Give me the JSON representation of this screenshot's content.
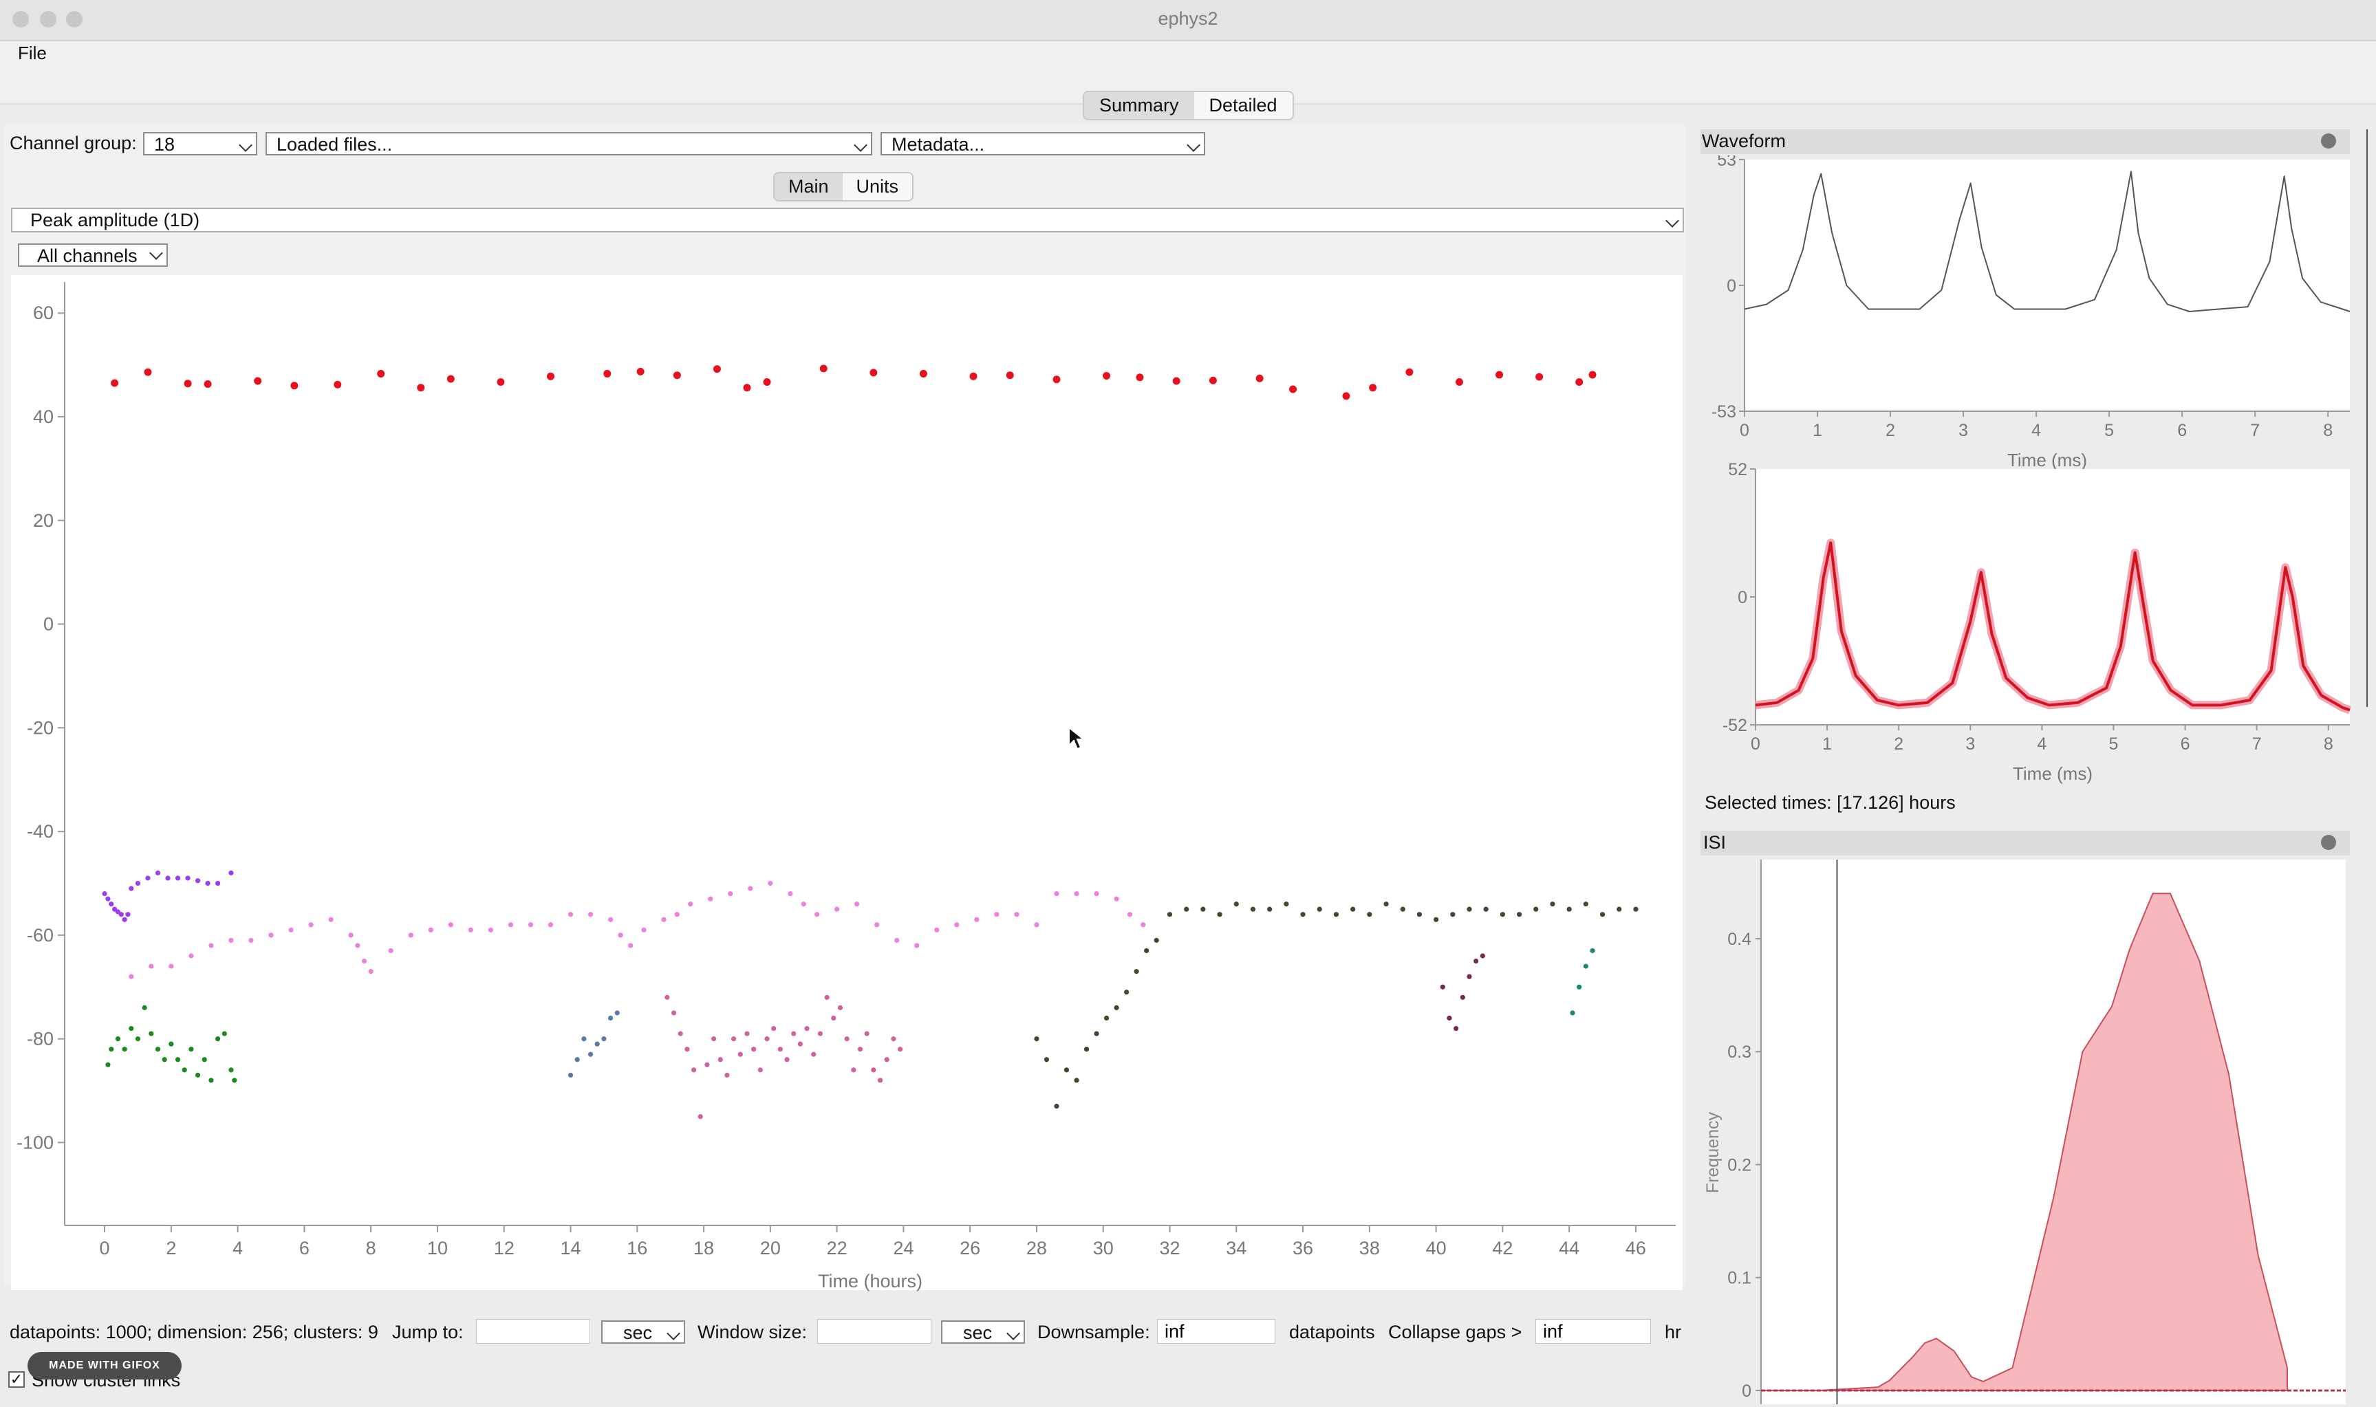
{
  "window": {
    "title": "ephys2"
  },
  "menu": {
    "file": "File"
  },
  "top_tabs": {
    "summary": "Summary",
    "detailed": "Detailed",
    "active": "Summary"
  },
  "controls": {
    "channel_group_label": "Channel group:",
    "channel_group_value": "18",
    "loaded_files": "Loaded files...",
    "metadata": "Metadata..."
  },
  "sub_tabs": {
    "main": "Main",
    "units": "Units",
    "active": "Main"
  },
  "plot_select": "Peak amplitude (1D)",
  "channel_select": "All channels",
  "waveform_panel": {
    "title": "Waveform"
  },
  "selected_times": "Selected times: [17.126] hours",
  "isi_panel": {
    "title": "ISI"
  },
  "status": {
    "summary": "datapoints: 1000; dimension: 256; clusters: 9",
    "jump_to_label": "Jump to:",
    "jump_to_value": "",
    "jump_unit": "sec",
    "window_size_label": "Window size:",
    "window_size_value": "",
    "window_unit": "sec",
    "downsample_label": "Downsample:",
    "downsample_value": "inf",
    "datapoints_label": "datapoints",
    "collapse_label": "Collapse gaps >",
    "collapse_value": "inf",
    "collapse_unit": "hr",
    "show_links_label": "Show cluster links",
    "show_links_checked": true,
    "gifox_badge": "MADE WITH GIFOX"
  },
  "colors": {
    "cluster_red": "#e8101d",
    "cluster_purple": "#9b3cf0",
    "cluster_pink": "#ef7fdc",
    "cluster_magenta": "#d1609c",
    "cluster_green": "#1a8a1a",
    "cluster_steel": "#5a79a8",
    "cluster_darkgreen": "#3d4a30",
    "cluster_maroon": "#7a2c3c",
    "cluster_teal": "#1c8a6e",
    "waveform_black": "#555555",
    "waveform_red": "#d4141c",
    "isi_fill": "#f6b8bc",
    "isi_line": "#c94f5a"
  },
  "chart_data": [
    {
      "type": "scatter",
      "title": "",
      "xlabel": "Time (hours)",
      "ylabel": "",
      "xlim": [
        -1.2,
        47.2
      ],
      "ylim": [
        -116,
        66
      ],
      "xticks": [
        0,
        2,
        4,
        6,
        8,
        10,
        12,
        14,
        16,
        18,
        20,
        22,
        24,
        26,
        28,
        30,
        32,
        34,
        36,
        38,
        40,
        42,
        44,
        46
      ],
      "yticks": [
        60,
        40,
        20,
        0,
        -20,
        -40,
        -60,
        -80,
        -100
      ],
      "grid": false,
      "series": [
        {
          "color": "#e8101d",
          "marker": "big",
          "x": [
            0.3,
            1.3,
            2.5,
            3.1,
            4.6,
            5.7,
            7.0,
            8.3,
            9.5,
            10.4,
            11.9,
            13.4,
            15.1,
            16.1,
            17.2,
            18.4,
            19.3,
            19.9,
            21.6,
            23.1,
            24.6,
            26.1,
            27.2,
            28.6,
            30.1,
            31.1,
            32.2,
            33.3,
            34.7,
            35.7,
            37.3,
            38.1,
            39.2,
            40.7,
            41.9,
            43.1,
            44.3,
            44.7
          ],
          "y": [
            46.5,
            48.6,
            46.4,
            46.3,
            46.9,
            46.0,
            46.2,
            48.3,
            45.6,
            47.3,
            46.7,
            47.8,
            48.3,
            48.7,
            48.0,
            49.2,
            45.6,
            46.7,
            49.3,
            48.5,
            48.3,
            47.8,
            48.0,
            47.2,
            47.9,
            47.6,
            46.9,
            47.0,
            47.4,
            45.3,
            44.0,
            45.6,
            48.6,
            46.7,
            48.1,
            47.7,
            46.7,
            48.1
          ]
        },
        {
          "color": "#9b3cf0",
          "marker": "small",
          "x": [
            0.0,
            0.1,
            0.2,
            0.3,
            0.4,
            0.5,
            0.6,
            0.7,
            0.8,
            1.0,
            1.3,
            1.6,
            1.9,
            2.2,
            2.5,
            2.8,
            3.1,
            3.4,
            3.8
          ],
          "y": [
            -52,
            -53,
            -54,
            -55,
            -55.5,
            -56,
            -57,
            -56,
            -51,
            -50,
            -49,
            -48,
            -49,
            -49,
            -49,
            -49.5,
            -50,
            -50,
            -48
          ]
        },
        {
          "color": "#ef7fdc",
          "marker": "small",
          "x": [
            0.8,
            1.4,
            2.0,
            2.6,
            3.2,
            3.8,
            4.4,
            5.0,
            5.6,
            6.2,
            6.8,
            7.4,
            7.6,
            7.8,
            8.0,
            8.6,
            9.2,
            9.8,
            10.4,
            11.0,
            11.6,
            12.2,
            12.8,
            13.4,
            14.0,
            14.6,
            15.2,
            15.5,
            15.8,
            16.2,
            16.8,
            17.2,
            17.6,
            18.2,
            18.8,
            19.4,
            20.0,
            20.6,
            21.0,
            21.4,
            22.0,
            22.6,
            23.2,
            23.8,
            24.4,
            25.0,
            25.6,
            26.2,
            26.8,
            27.4,
            28.0,
            28.6,
            29.2,
            29.8,
            30.4,
            30.8,
            31.2
          ],
          "y": [
            -68,
            -66,
            -66,
            -64,
            -62,
            -61,
            -61,
            -60,
            -59,
            -58,
            -57,
            -60,
            -62,
            -65,
            -67,
            -63,
            -60,
            -59,
            -58,
            -59,
            -59,
            -58,
            -58,
            -58,
            -56,
            -56,
            -57,
            -60,
            -62,
            -59,
            -57,
            -56,
            -54,
            -53,
            -52,
            -51,
            -50,
            -52,
            -54,
            -56,
            -55,
            -54,
            -58,
            -61,
            -62,
            -59,
            -58,
            -57,
            -56,
            -56,
            -58,
            -52,
            -52,
            -52,
            -53,
            -56,
            -58
          ]
        },
        {
          "color": "#d1609c",
          "marker": "small",
          "x": [
            16.9,
            17.1,
            17.3,
            17.5,
            17.7,
            17.9,
            18.1,
            18.3,
            18.5,
            18.7,
            18.9,
            19.1,
            19.3,
            19.5,
            19.7,
            19.9,
            20.1,
            20.3,
            20.5,
            20.7,
            20.9,
            21.1,
            21.3,
            21.5,
            21.7,
            21.9,
            22.1,
            22.3,
            22.5,
            22.7,
            22.9,
            23.1,
            23.3,
            23.5,
            23.7,
            23.9
          ],
          "y": [
            -72,
            -75,
            -79,
            -82,
            -86,
            -95,
            -85,
            -80,
            -84,
            -87,
            -80,
            -83,
            -79,
            -82,
            -86,
            -80,
            -78,
            -82,
            -84,
            -79,
            -81,
            -78,
            -83,
            -79,
            -72,
            -76,
            -74,
            -80,
            -86,
            -82,
            -79,
            -86,
            -88,
            -84,
            -80,
            -82
          ]
        },
        {
          "color": "#1a8a1a",
          "marker": "small",
          "x": [
            0.1,
            0.2,
            0.4,
            0.6,
            0.8,
            1.0,
            1.2,
            1.4,
            1.6,
            1.8,
            2.0,
            2.2,
            2.4,
            2.6,
            2.8,
            3.0,
            3.2,
            3.4,
            3.6,
            3.8,
            3.9
          ],
          "y": [
            -85,
            -82,
            -80,
            -82,
            -78,
            -80,
            -74,
            -79,
            -82,
            -84,
            -81,
            -84,
            -86,
            -82,
            -87,
            -84,
            -88,
            -80,
            -79,
            -86,
            -88
          ]
        },
        {
          "color": "#5a79a8",
          "marker": "small",
          "x": [
            14.0,
            14.2,
            14.4,
            14.6,
            14.8,
            15.0,
            15.2,
            15.4
          ],
          "y": [
            -87,
            -84,
            -80,
            -83,
            -81,
            -80,
            -76,
            -75
          ]
        },
        {
          "color": "#3d4a30",
          "marker": "small",
          "x": [
            28.0,
            28.3,
            28.6,
            28.9,
            29.2,
            29.5,
            29.8,
            30.1,
            30.4,
            30.7,
            31.0,
            31.3,
            31.6,
            32.0,
            32.5,
            33.0,
            33.5,
            34.0,
            34.5,
            35.0,
            35.5,
            36.0,
            36.5,
            37.0,
            37.5,
            38.0,
            38.5,
            39.0,
            39.5,
            40.0,
            40.5,
            41.0,
            41.5,
            42.0,
            42.5,
            43.0,
            43.5,
            44.0,
            44.5,
            45.0,
            45.5,
            46.0
          ],
          "y": [
            -80,
            -84,
            -93,
            -86,
            -88,
            -82,
            -79,
            -76,
            -74,
            -71,
            -67,
            -63,
            -61,
            -56,
            -55,
            -55,
            -56,
            -54,
            -55,
            -55,
            -54,
            -56,
            -55,
            -56,
            -55,
            -56,
            -54,
            -55,
            -56,
            -57,
            -56,
            -55,
            -55,
            -56,
            -56,
            -55,
            -54,
            -55,
            -54,
            -56,
            -55,
            -55
          ]
        },
        {
          "color": "#7a2c3c",
          "marker": "small",
          "x": [
            40.2,
            40.4,
            40.6,
            40.8,
            41.0,
            41.2,
            41.4
          ],
          "y": [
            -70,
            -76,
            -78,
            -72,
            -68,
            -65,
            -64
          ]
        },
        {
          "color": "#1c8a6e",
          "marker": "small",
          "x": [
            44.1,
            44.3,
            44.5,
            44.7
          ],
          "y": [
            -75,
            -70,
            -66,
            -63
          ]
        }
      ]
    },
    {
      "type": "line",
      "title": "",
      "xlabel": "Time (ms)",
      "ylabel": "",
      "xlim": [
        0,
        8.3
      ],
      "ylim": [
        -53,
        53
      ],
      "xticks": [
        0,
        1,
        2,
        3,
        4,
        5,
        6,
        7,
        8
      ],
      "yticks": [
        "53",
        "0",
        "-53"
      ],
      "series": [
        {
          "color": "#555555",
          "x": [
            0,
            0.3,
            0.6,
            0.8,
            0.95,
            1.05,
            1.2,
            1.4,
            1.7,
            2.0,
            2.4,
            2.7,
            2.95,
            3.1,
            3.25,
            3.45,
            3.7,
            4.0,
            4.4,
            4.8,
            5.1,
            5.3,
            5.4,
            5.55,
            5.8,
            6.1,
            6.5,
            6.9,
            7.2,
            7.4,
            7.5,
            7.65,
            7.9,
            8.2,
            8.3
          ],
          "y": [
            -10,
            -8,
            -2,
            15,
            38,
            47,
            22,
            0,
            -10,
            -10,
            -10,
            -2,
            28,
            43,
            16,
            -4,
            -10,
            -10,
            -10,
            -6,
            15,
            48,
            22,
            3,
            -8,
            -11,
            -10,
            -9,
            10,
            46,
            24,
            3,
            -7,
            -10,
            -11
          ]
        }
      ]
    },
    {
      "type": "line",
      "title": "",
      "xlabel": "Time (ms)",
      "ylabel": "",
      "xlim": [
        0,
        8.3
      ],
      "ylim": [
        -52,
        52
      ],
      "xticks": [
        0,
        1,
        2,
        3,
        4,
        5,
        6,
        7,
        8
      ],
      "yticks": [
        "52",
        "0",
        "-52"
      ],
      "series": [
        {
          "color": "#d4141c",
          "x": [
            0,
            0.3,
            0.6,
            0.8,
            0.95,
            1.05,
            1.2,
            1.4,
            1.7,
            2.0,
            2.4,
            2.75,
            3.0,
            3.15,
            3.3,
            3.5,
            3.8,
            4.1,
            4.5,
            4.9,
            5.1,
            5.3,
            5.4,
            5.55,
            5.8,
            6.1,
            6.5,
            6.9,
            7.2,
            7.4,
            7.5,
            7.65,
            7.9,
            8.2,
            8.3
          ],
          "y": [
            -44,
            -43,
            -38,
            -25,
            8,
            22,
            -14,
            -32,
            -42,
            -44,
            -43,
            -35,
            -10,
            10,
            -15,
            -33,
            -41,
            -44,
            -43,
            -37,
            -20,
            18,
            0,
            -26,
            -38,
            -44,
            -44,
            -42,
            -30,
            12,
            0,
            -28,
            -40,
            -45,
            -46
          ]
        }
      ]
    },
    {
      "type": "area",
      "title": "",
      "xlabel": "",
      "ylabel": "Frequency",
      "xlim": [
        0,
        1
      ],
      "ylim": [
        0,
        0.47
      ],
      "yticks": [
        0.4,
        0.3,
        0.2,
        0.1,
        0
      ],
      "series": [
        {
          "color": "#f6b8bc",
          "x": [
            0.0,
            0.1,
            0.2,
            0.22,
            0.26,
            0.28,
            0.3,
            0.33,
            0.36,
            0.38,
            0.43,
            0.5,
            0.55,
            0.6,
            0.63,
            0.67,
            0.7,
            0.75,
            0.8,
            0.85,
            0.89,
            0.9
          ],
          "y": [
            0,
            0,
            0.003,
            0.009,
            0.03,
            0.042,
            0.046,
            0.035,
            0.012,
            0.008,
            0.02,
            0.17,
            0.3,
            0.34,
            0.39,
            0.44,
            0.44,
            0.38,
            0.28,
            0.12,
            0.04,
            0.02
          ]
        }
      ]
    }
  ]
}
